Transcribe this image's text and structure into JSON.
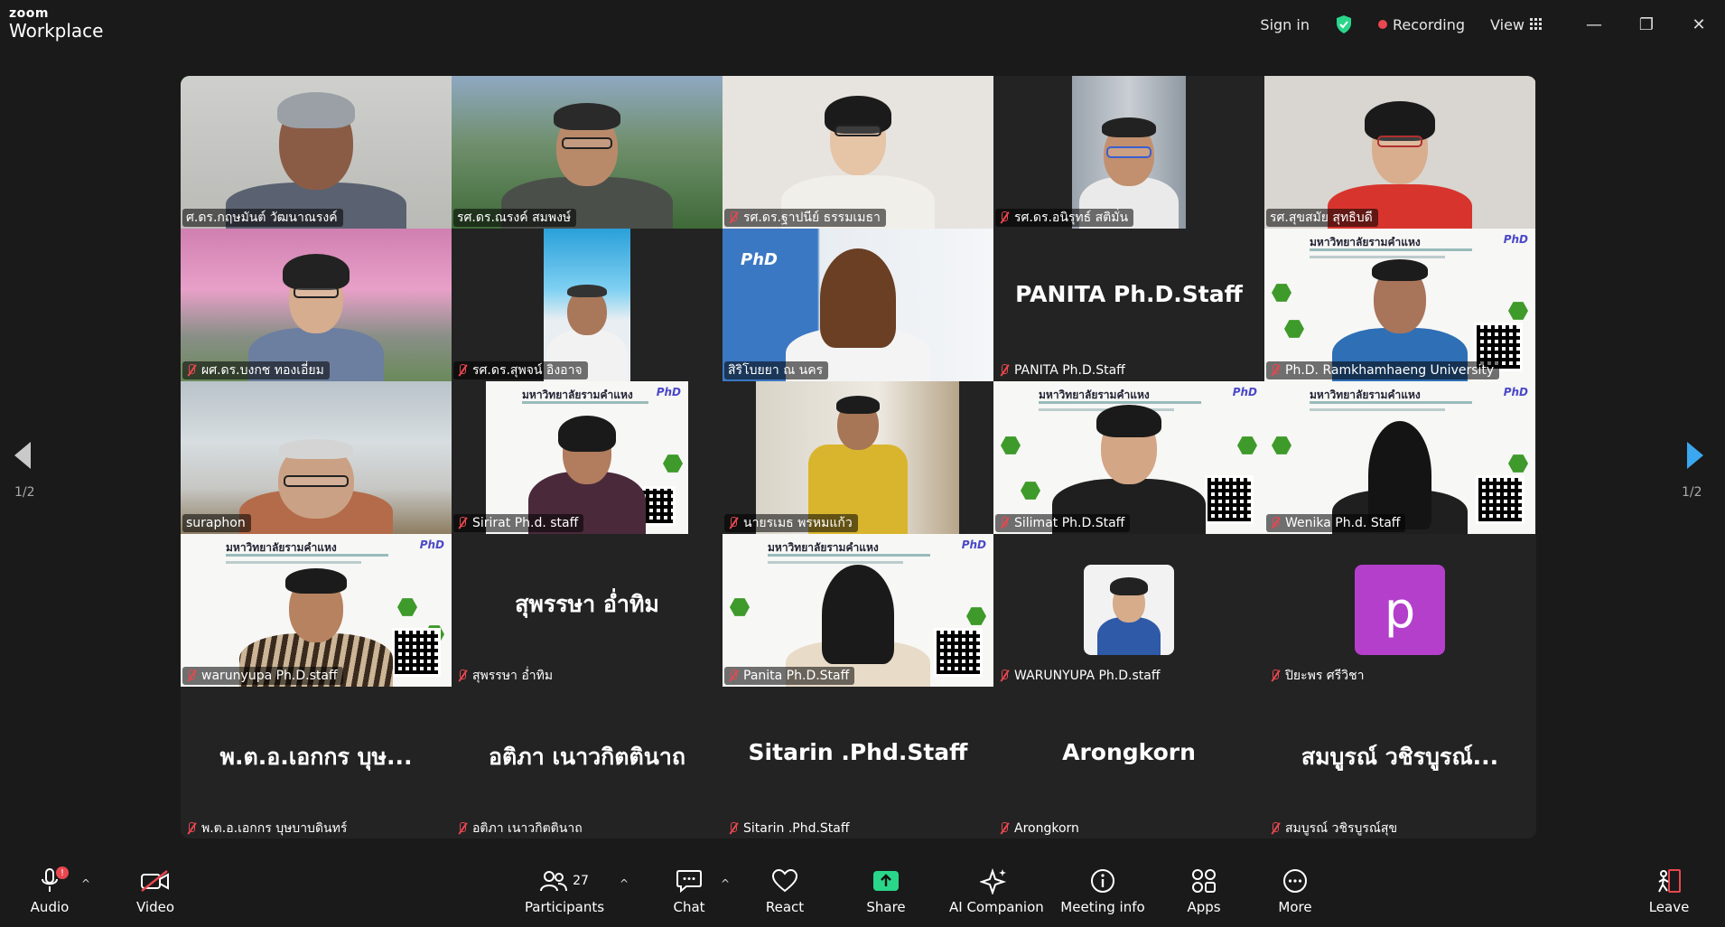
{
  "app": {
    "logo_line1": "zoom",
    "logo_line2": "Workplace"
  },
  "topbar": {
    "sign_in": "Sign in",
    "recording": "Recording",
    "view": "View",
    "shield_color": "#2ad68a"
  },
  "page": {
    "left": "1/2",
    "right": "1/2"
  },
  "tiles": [
    {
      "name": "ศ.ดร.กฤษมันต์ วัฒนาณรงค์",
      "muted": false,
      "active": true
    },
    {
      "name": "รศ.ดร.ณรงค์ สมพงษ์",
      "muted": false
    },
    {
      "name": "รศ.ดร.ฐาปนีย์ ธรรมเมธา",
      "muted": true
    },
    {
      "name": "รศ.ดร.อนิรุทธ์ สติมั่น",
      "muted": true
    },
    {
      "name": "รศ.สุขสมัย สุทธิบดี",
      "muted": false
    },
    {
      "name": "ผศ.ดร.บงกช ทองเอี่ยม",
      "muted": true
    },
    {
      "name": "รศ.ดร.สุพจน์ อิงอาจ",
      "muted": true
    },
    {
      "name": "สิริโบยยา ณ นคร",
      "muted": false
    },
    {
      "name": "PANITA Ph.D.Staff",
      "muted": true,
      "big": "PANITA Ph.D.Staff"
    },
    {
      "name": "Ph.D. Ramkhamhaeng University",
      "muted": true
    },
    {
      "name": "suraphon",
      "muted": false
    },
    {
      "name": "Sirirat Ph.d. staff",
      "muted": true
    },
    {
      "name": "นายรเมธ พรหมแก้ว",
      "muted": true
    },
    {
      "name": "Silimat Ph.D.Staff",
      "muted": true
    },
    {
      "name": "Wenika Ph.d. Staff",
      "muted": true
    },
    {
      "name": "warunyupa Ph.D.staff",
      "muted": true
    },
    {
      "name": "สุพรรษา อ่ำทิม",
      "muted": true,
      "big": "สุพรรษา อ่ำทิม"
    },
    {
      "name": "Panita Ph.D.Staff",
      "muted": true
    },
    {
      "name": "WARUNYUPA Ph.D.staff",
      "muted": true
    },
    {
      "name": "ปิยะพร ศรีวิชา",
      "muted": true,
      "avatar_letter": "p"
    },
    {
      "name": "พ.ต.อ.เอกกร บุษบาบดินทร์",
      "muted": true,
      "big": "พ.ต.อ.เอกกร บุษ..."
    },
    {
      "name": "อติภา เนาวกิตตินาถ",
      "muted": true,
      "big": "อติภา เนาวกิตตินาถ"
    },
    {
      "name": "Sitarin .Phd.Staff",
      "muted": true,
      "big": "Sitarin .Phd.Staff"
    },
    {
      "name": "Arongkorn",
      "muted": true,
      "big": "Arongkorn"
    },
    {
      "name": "สมบูรณ์ วชิรบูรณ์สุข",
      "muted": true,
      "big": "สมบูรณ์ วชิรบูรณ์..."
    }
  ],
  "poster": {
    "title": "มหาวิทยาลัยรามคำแหง",
    "badge": "PhD"
  },
  "toolbar": {
    "audio": "Audio",
    "audio_badge": "!",
    "video": "Video",
    "participants": "Participants",
    "participants_count": "27",
    "chat": "Chat",
    "react": "React",
    "share": "Share",
    "ai_companion": "AI Companion",
    "meeting_info": "Meeting info",
    "apps": "Apps",
    "more": "More",
    "leave": "Leave",
    "share_color": "#2ad68a",
    "leave_color": "#e8474f"
  }
}
